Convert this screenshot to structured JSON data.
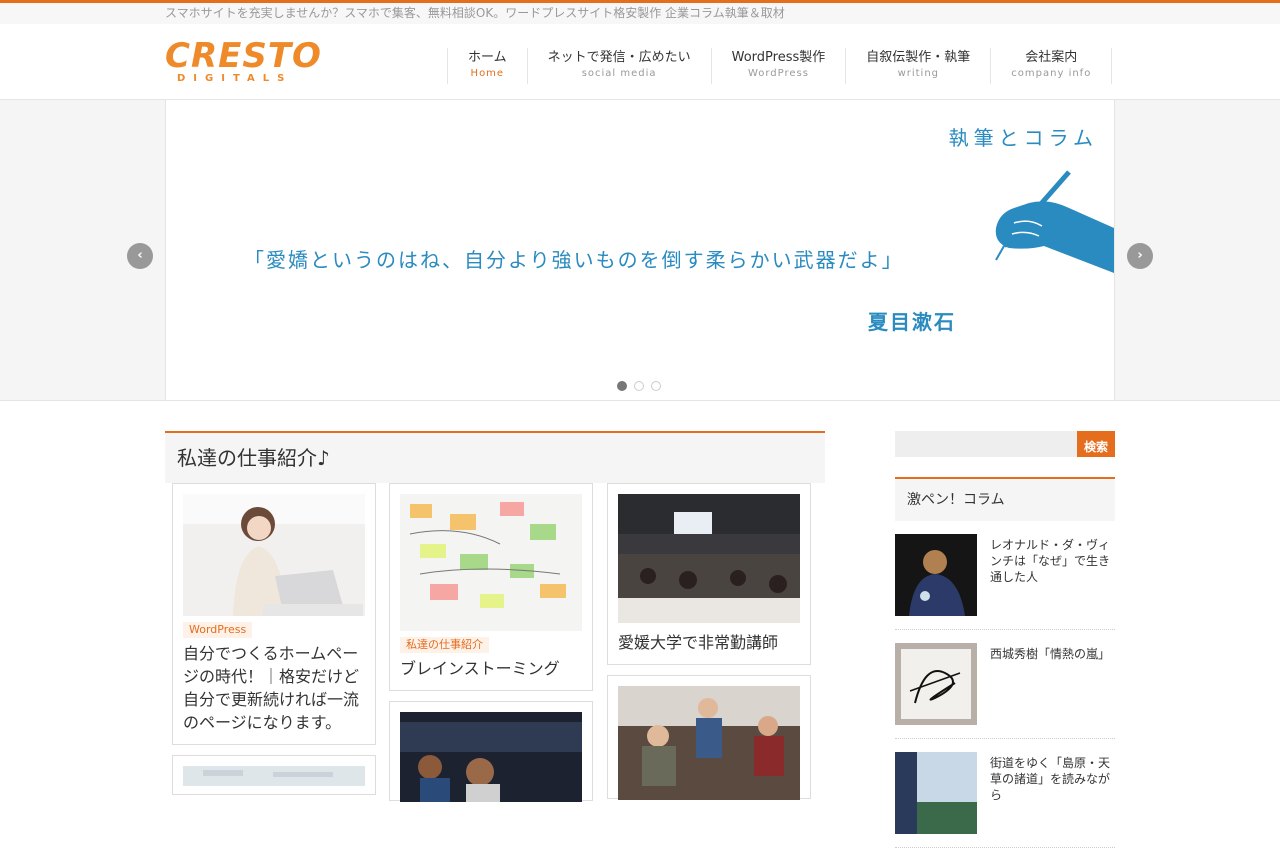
{
  "topbar": {
    "tagline": "スマホサイトを充実しませんか？スマホで集客、無料相談OK。ワードプレスサイト格安製作 企業コラム執筆＆取材"
  },
  "logo": {
    "word": "CRESTO",
    "sub": "DIGITALS"
  },
  "nav": [
    {
      "ja": "ホーム",
      "en": "Home"
    },
    {
      "ja": "ネットで発信・広めたい",
      "en": "social media"
    },
    {
      "ja": "WordPress製作",
      "en": "WordPress"
    },
    {
      "ja": "自叙伝製作・執筆",
      "en": "writing"
    },
    {
      "ja": "会社案内",
      "en": "company info"
    }
  ],
  "hero": {
    "heading": "執筆とコラム",
    "quote": "「愛嬌というのはね、自分より強いものを倒す柔らかい武器だよ」",
    "author": "夏目漱石",
    "prev": "‹",
    "next": "›"
  },
  "main": {
    "title": "私達の仕事紹介♪",
    "cards": [
      {
        "tag": "WordPress",
        "title": "自分でつくるホームページの時代！｜格安だけど自分で更新続ければ一流のページになります。"
      },
      {
        "tag": "私達の仕事紹介",
        "title": "ブレインストーミング"
      },
      {
        "tag": "",
        "title": "愛媛大学で非常勤講師"
      }
    ]
  },
  "sidebar": {
    "search_placeholder": "",
    "search_button": "検索",
    "column_title": "激ペン！コラム",
    "posts": [
      {
        "title": "レオナルド・ダ・ヴィンチは「なぜ」で生き通した人"
      },
      {
        "title": "西城秀樹「情熱の嵐」"
      },
      {
        "title": "街道をゆく「島原・天草の諸道」を読みながら"
      }
    ]
  },
  "colors": {
    "accent": "#e56d1e",
    "hero_blue": "#2a8bc0"
  }
}
